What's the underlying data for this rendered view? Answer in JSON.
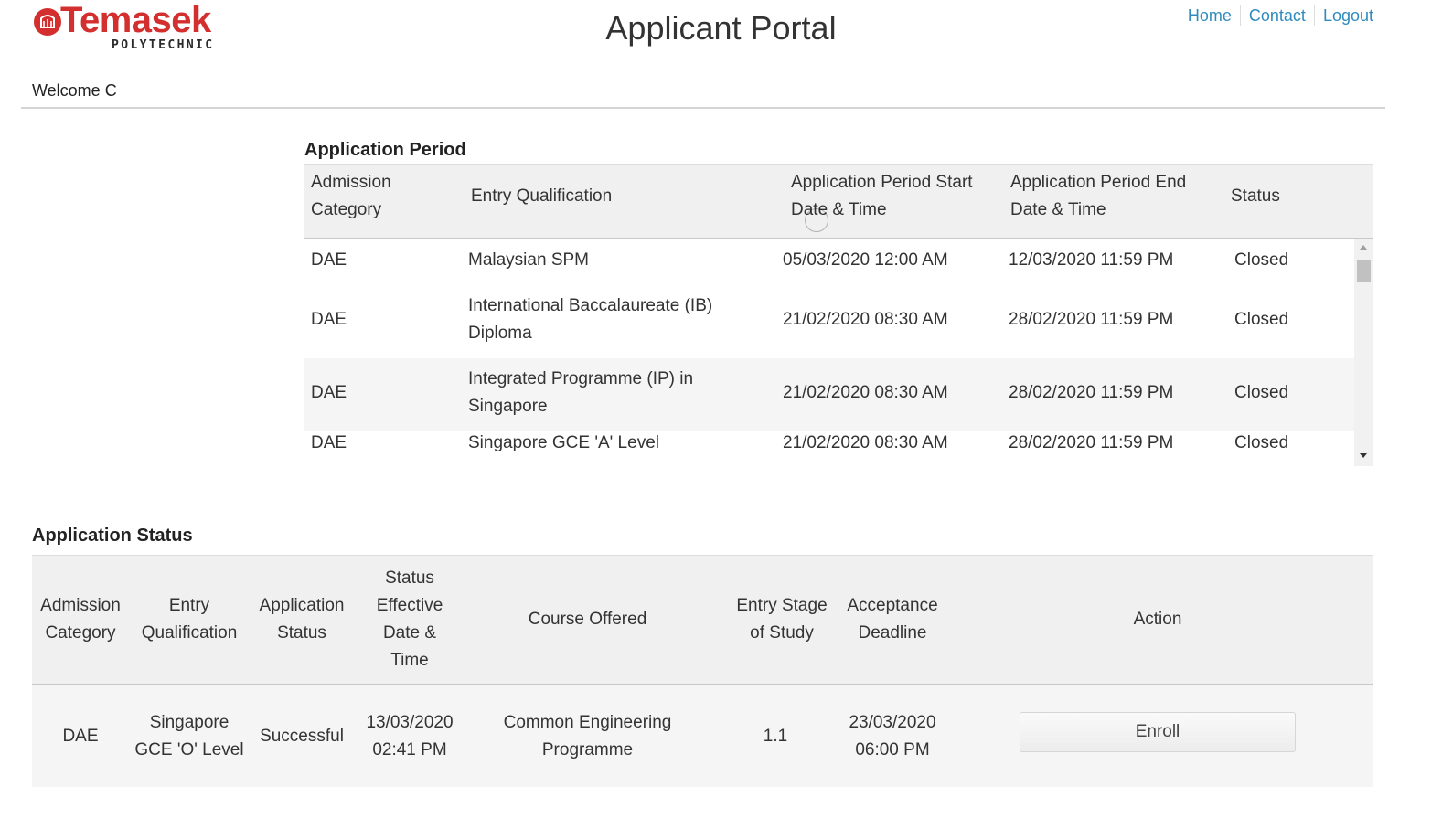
{
  "brand": {
    "name": "Temasek",
    "sub": "POLYTECHNIC"
  },
  "header": {
    "title": "Applicant Portal"
  },
  "nav": [
    {
      "label": "Home"
    },
    {
      "label": "Contact"
    },
    {
      "label": "Logout"
    }
  ],
  "welcome": "Welcome C",
  "period": {
    "title": "Application Period",
    "columns": [
      "Admission Category",
      "Entry Qualification",
      "Application Period Start Date & Time",
      "Application Period End Date & Time",
      "Status"
    ],
    "rows": [
      {
        "category": "DAE",
        "qualification": "Malaysian SPM",
        "start": "05/03/2020 12:00 AM",
        "end": "12/03/2020 11:59 PM",
        "status": "Closed"
      },
      {
        "category": "DAE",
        "qualification": "International Baccalaureate (IB) Diploma",
        "start": "21/02/2020 08:30 AM",
        "end": "28/02/2020 11:59 PM",
        "status": "Closed"
      },
      {
        "category": "DAE",
        "qualification": "Integrated Programme (IP) in Singapore",
        "start": "21/02/2020 08:30 AM",
        "end": "28/02/2020 11:59 PM",
        "status": "Closed"
      },
      {
        "category": "DAE",
        "qualification": "Singapore GCE 'A' Level",
        "start": "21/02/2020 08:30 AM",
        "end": "28/02/2020 11:59 PM",
        "status": "Closed"
      }
    ]
  },
  "status_section": {
    "title": "Application Status",
    "columns": [
      "Admission Category",
      "Entry Qualification",
      "Application Status",
      "Status Effective Date & Time",
      "Course Offered",
      "Entry Stage of Study",
      "Acceptance Deadline",
      "Action"
    ],
    "row": {
      "category": "DAE",
      "qualification": "Singapore GCE 'O' Level",
      "app_status": "Successful",
      "effective": "13/03/2020 02:41 PM",
      "course": "Common Engineering Programme",
      "stage": "1.1",
      "deadline": "23/03/2020 06:00 PM",
      "action": "Enroll"
    }
  },
  "colors": {
    "brand_red": "#d32f2f",
    "link": "#2f8bbd"
  }
}
